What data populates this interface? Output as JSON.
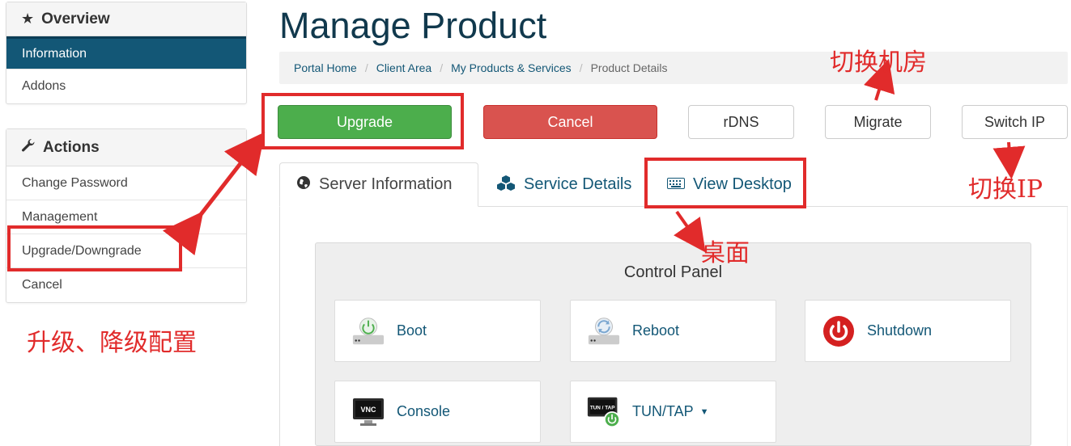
{
  "sidebar": {
    "overview": {
      "title": "Overview",
      "items": [
        "Information",
        "Addons"
      ]
    },
    "actions": {
      "title": "Actions",
      "items": [
        "Change Password",
        "Management",
        "Upgrade/Downgrade",
        "Cancel"
      ]
    }
  },
  "page": {
    "title": "Manage Product"
  },
  "breadcrumb": [
    "Portal Home",
    "Client Area",
    "My Products & Services",
    "Product Details"
  ],
  "buttons": {
    "upgrade": "Upgrade",
    "cancel": "Cancel",
    "rdns": "rDNS",
    "migrate": "Migrate",
    "switch_ip": "Switch IP"
  },
  "tabs": [
    "Server Information",
    "Service Details",
    "View Desktop"
  ],
  "control_panel": {
    "title": "Control Panel",
    "items": [
      "Boot",
      "Reboot",
      "Shutdown",
      "Console",
      "TUN/TAP"
    ],
    "vnc_badge": "VNC",
    "tuntap_badge": "TUN / TAP"
  },
  "annotations": {
    "upgrade_downgrade": "升级、降级配置",
    "migrate": "切换机房",
    "switch_ip": "切换IP",
    "desktop": "桌面"
  },
  "colors": {
    "primary": "#135776",
    "annotation_red": "#e12b2b",
    "upgrade_green": "#4cae4c",
    "cancel_red": "#d9534f"
  }
}
